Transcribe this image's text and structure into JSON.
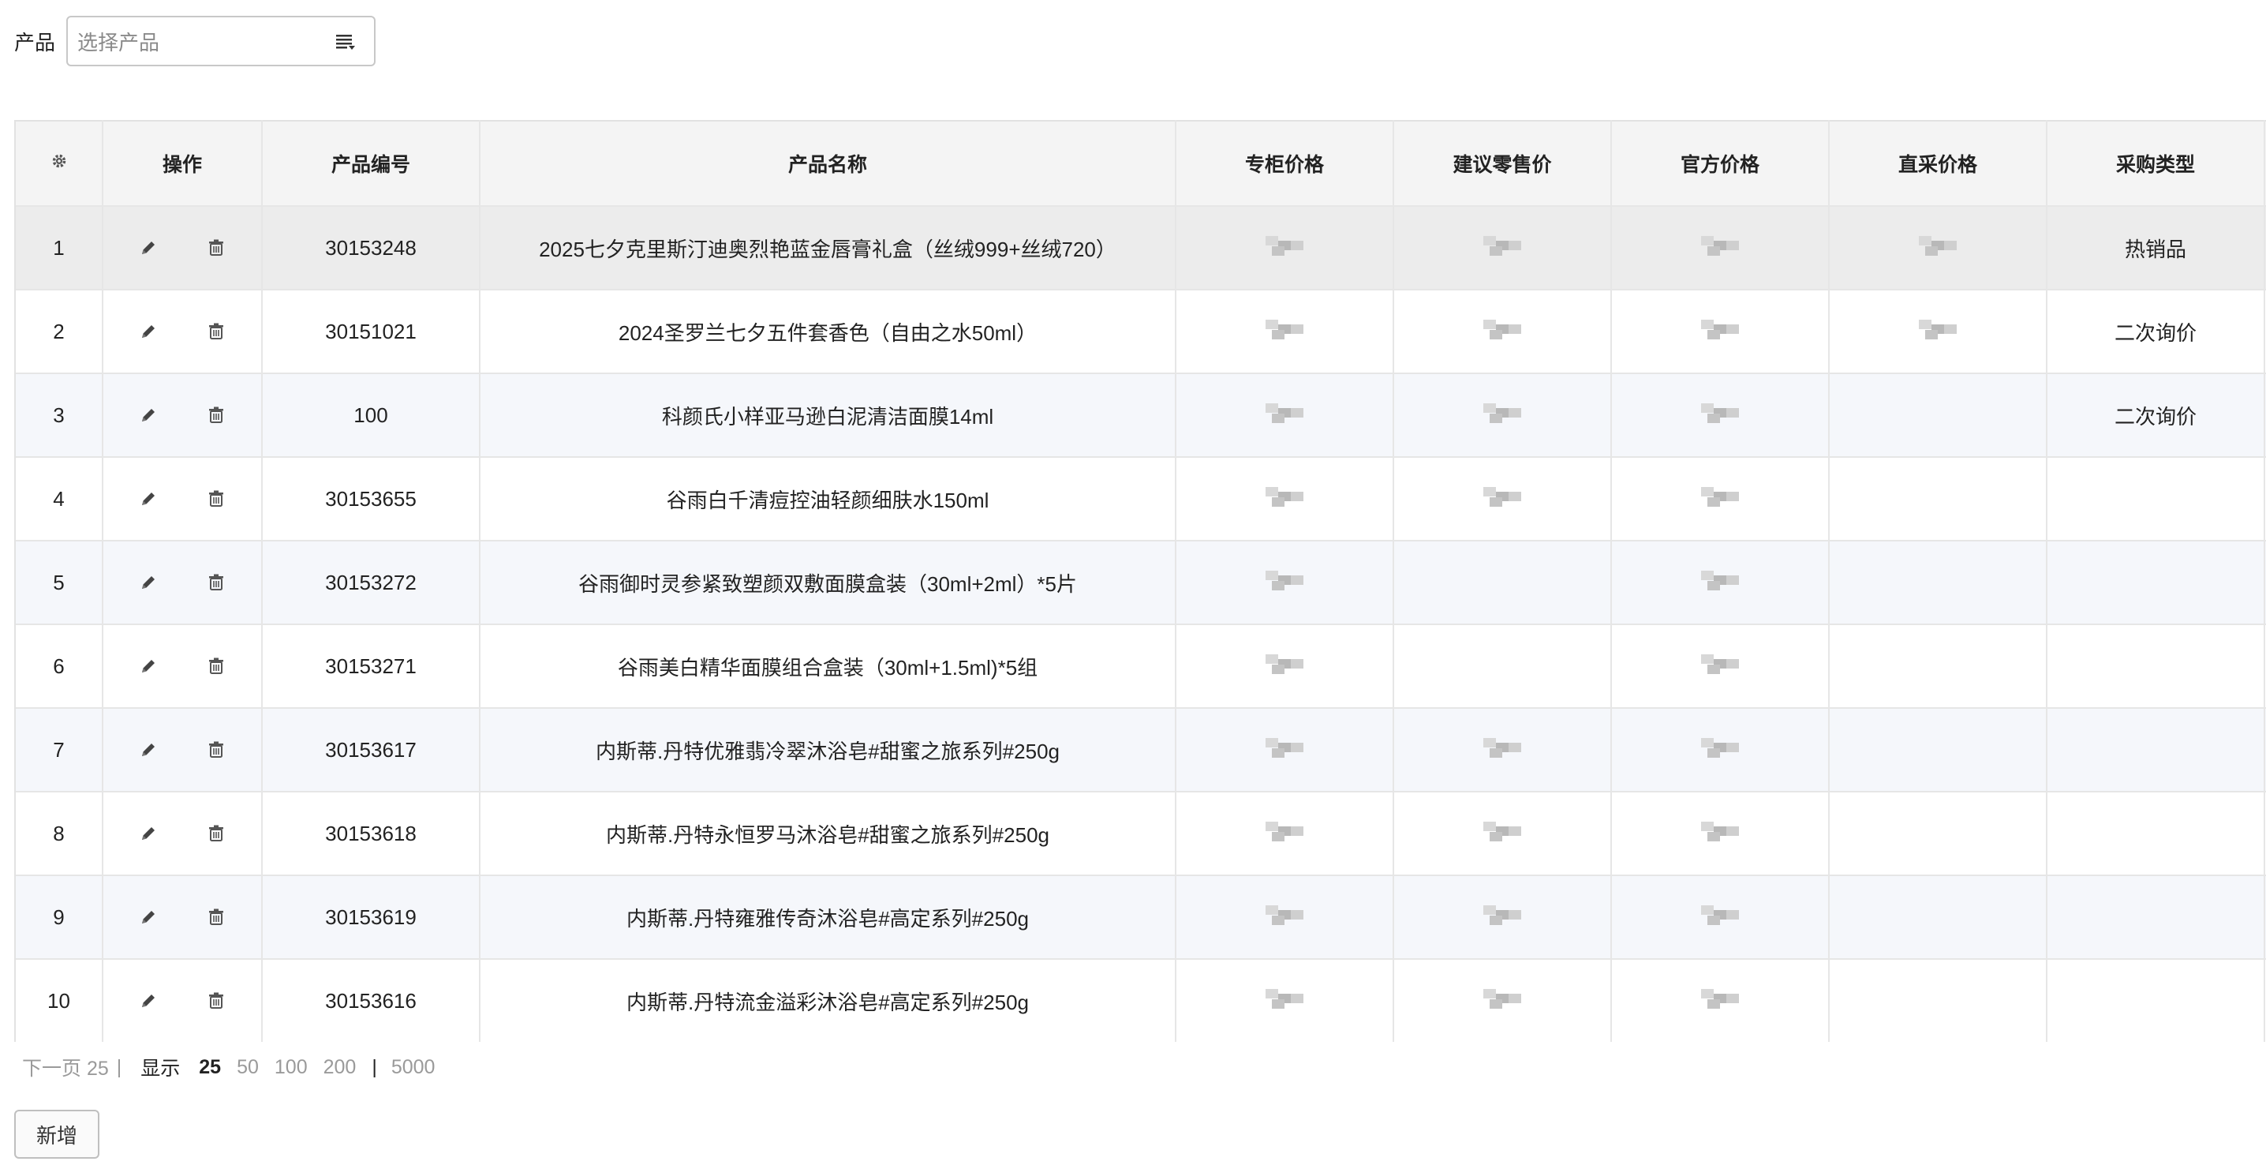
{
  "filter": {
    "label": "产品",
    "placeholder": "选择产品",
    "icon": "list-dropdown-icon"
  },
  "table": {
    "settings_icon": "gear-icon",
    "columns": [
      "操作",
      "产品编号",
      "产品名称",
      "专柜价格",
      "建议零售价",
      "官方价格",
      "直采价格",
      "采购类型"
    ],
    "rows": [
      {
        "index": "1",
        "code": "30153248",
        "name": "2025七夕克里斯汀迪奥烈艳蓝金唇膏礼盒（丝绒999+丝绒720）",
        "purchase_type": "热销品",
        "prices_blurred": [
          true,
          true,
          true,
          true
        ]
      },
      {
        "index": "2",
        "code": "30151021",
        "name": "2024圣罗兰七夕五件套香色（自由之水50ml）",
        "purchase_type": "二次询价",
        "prices_blurred": [
          true,
          true,
          true,
          true
        ]
      },
      {
        "index": "3",
        "code": "100",
        "name": "科颜氏小样亚马逊白泥清洁面膜14ml",
        "purchase_type": "二次询价",
        "prices_blurred": [
          true,
          true,
          true,
          false
        ]
      },
      {
        "index": "4",
        "code": "30153655",
        "name": "谷雨白千清痘控油轻颜细肤水150ml",
        "purchase_type": "",
        "prices_blurred": [
          true,
          true,
          true,
          false
        ]
      },
      {
        "index": "5",
        "code": "30153272",
        "name": "谷雨御时灵参紧致塑颜双敷面膜盒装（30ml+2ml）*5片",
        "purchase_type": "",
        "prices_blurred": [
          true,
          false,
          true,
          false
        ]
      },
      {
        "index": "6",
        "code": "30153271",
        "name": "谷雨美白精华面膜组合盒装（30ml+1.5ml)*5组",
        "purchase_type": "",
        "prices_blurred": [
          true,
          false,
          true,
          false
        ]
      },
      {
        "index": "7",
        "code": "30153617",
        "name": "内斯蒂.丹特优雅翡冷翠沐浴皂#甜蜜之旅系列#250g",
        "purchase_type": "",
        "prices_blurred": [
          true,
          true,
          true,
          false
        ]
      },
      {
        "index": "8",
        "code": "30153618",
        "name": "内斯蒂.丹特永恒罗马沐浴皂#甜蜜之旅系列#250g",
        "purchase_type": "",
        "prices_blurred": [
          true,
          true,
          true,
          false
        ]
      },
      {
        "index": "9",
        "code": "30153619",
        "name": "内斯蒂.丹特雍雅传奇沐浴皂#高定系列#250g",
        "purchase_type": "",
        "prices_blurred": [
          true,
          true,
          true,
          false
        ]
      },
      {
        "index": "10",
        "code": "30153616",
        "name": "内斯蒂.丹特流金溢彩沐浴皂#高定系列#250g",
        "purchase_type": "",
        "prices_blurred": [
          true,
          true,
          true,
          false
        ]
      }
    ],
    "row_icons": {
      "edit": "pencil-icon",
      "delete": "trash-icon"
    }
  },
  "pager": {
    "next": "下一页 25",
    "divider": "|",
    "show_label": "显示",
    "sizes": [
      "25",
      "50",
      "100",
      "200"
    ],
    "active_size": "25",
    "divider2": "|",
    "max_size": "5000"
  },
  "add_button": {
    "label": "新增"
  }
}
